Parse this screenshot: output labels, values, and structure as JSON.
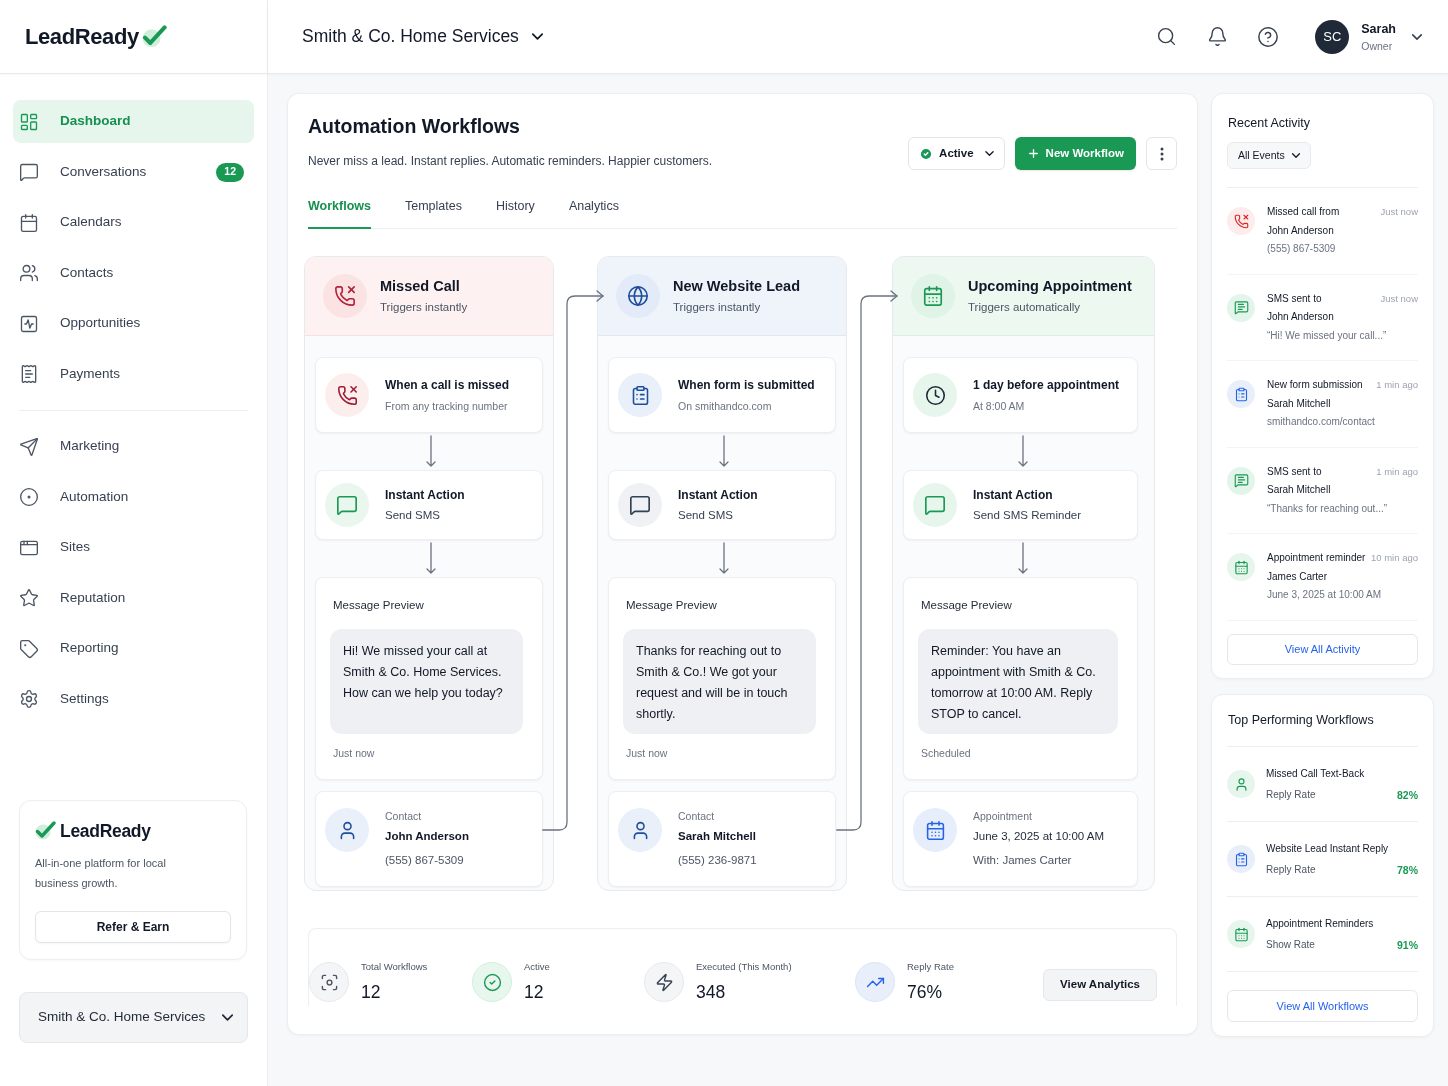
{
  "brand": {
    "name": "LeadReady"
  },
  "sidebar": {
    "sections": [
      {
        "items": [
          {
            "label": "Dashboard",
            "selected": true
          },
          {
            "label": "Conversations",
            "selected": false,
            "badge": "12"
          },
          {
            "label": "Calendars",
            "selected": false
          },
          {
            "label": "Contacts",
            "selected": false
          },
          {
            "label": "Opportunities",
            "selected": false
          },
          {
            "label": "Payments",
            "selected": false
          }
        ]
      },
      {
        "items": [
          {
            "label": "Marketing",
            "selected": false
          },
          {
            "label": "Automation",
            "selected": false
          },
          {
            "label": "Sites",
            "selected": false
          },
          {
            "label": "Reputation",
            "selected": false
          },
          {
            "label": "Reporting",
            "selected": false
          },
          {
            "label": "Settings",
            "selected": false
          }
        ]
      }
    ],
    "promo": {
      "brand": "LeadReady",
      "text": "All-in-one platform for local business growth.",
      "button": "Refer & Earn"
    },
    "account_select": {
      "value": "Smith & Co. Home Services"
    }
  },
  "top_bar": {
    "workspace": "Smith & Co. Home Services",
    "user": {
      "initials": "SC",
      "name": "Sarah",
      "role": "Owner"
    }
  },
  "page": {
    "title": "Automation Workflows",
    "subtitle": "Never miss a lead. Instant replies. Automatic reminders. Happier customers.",
    "status_filter": {
      "value": "Active"
    },
    "new_button": "New Workflow",
    "tabs": [
      {
        "label": "Workflows",
        "selected": true
      },
      {
        "label": "Templates",
        "selected": false
      },
      {
        "label": "History",
        "selected": false
      },
      {
        "label": "Analytics",
        "selected": false
      }
    ],
    "workflows": [
      {
        "kind": "call",
        "title": "Missed Call",
        "subtitle": "Triggers instantly",
        "trigger": {
          "title": "When a call is missed",
          "subtitle": "From any tracking number"
        },
        "action": {
          "label": "Instant Action",
          "value": "Send SMS"
        },
        "preview": {
          "label": "Message Preview",
          "message": "Hi! We missed your call at Smith & Co. Home Services. How can we help you today?",
          "footer": "Just now"
        },
        "info": {
          "kind": "contact",
          "label": "Contact",
          "lines": [
            "John Anderson",
            "(555) 867-5309"
          ]
        }
      },
      {
        "kind": "website_lead",
        "title": "New Website Lead",
        "subtitle": "Triggers instantly",
        "trigger": {
          "title": "When form is submitted",
          "subtitle": "On smithandco.com"
        },
        "action": {
          "label": "Instant Action",
          "value": "Send SMS"
        },
        "preview": {
          "label": "Message Preview",
          "message": "Thanks for reaching out to Smith & Co.! We got your request and will be in touch shortly.",
          "footer": "Just now"
        },
        "info": {
          "kind": "contact",
          "label": "Contact",
          "lines": [
            "Sarah Mitchell",
            "(555) 236-9871"
          ]
        }
      },
      {
        "kind": "appointment",
        "title": "Upcoming Appointment",
        "subtitle": "Triggers automatically",
        "trigger": {
          "title": "1 day before appointment",
          "subtitle": "At 8:00 AM"
        },
        "action": {
          "label": "Instant Action",
          "value": "Send SMS Reminder"
        },
        "preview": {
          "label": "Message Preview",
          "message": "Reminder: You have an appointment with Smith & Co. tomorrow at 10:00 AM. Reply STOP to cancel.",
          "footer": "Scheduled"
        },
        "info": {
          "kind": "appointment",
          "label": "Appointment",
          "lines": [
            "June 3, 2025 at 10:00 AM",
            "With: James Carter"
          ]
        }
      }
    ],
    "stats": [
      {
        "label": "Total Workflows",
        "value": "12"
      },
      {
        "label": "Active",
        "value": "12"
      },
      {
        "label": "Executed (This Month)",
        "value": "348"
      },
      {
        "label": "Reply Rate",
        "value": "76%"
      }
    ],
    "stats_button": "View Analytics"
  },
  "recent_activity": {
    "title": "Recent Activity",
    "filter": "All Events",
    "items": [
      {
        "kind": "call",
        "title": "Missed call from",
        "name": "John Anderson",
        "detail": "(555) 867-5309",
        "time": "Just now"
      },
      {
        "kind": "sms",
        "title": "SMS sent to",
        "name": "John Anderson",
        "detail": "“Hi! We missed your call...”",
        "time": "Just now"
      },
      {
        "kind": "form",
        "title": "New form submission",
        "name": "Sarah Mitchell",
        "detail": "smithandco.com/contact",
        "time": "1 min ago"
      },
      {
        "kind": "sms",
        "title": "SMS sent to",
        "name": "Sarah Mitchell",
        "detail": "“Thanks for reaching out...”",
        "time": "1 min ago"
      },
      {
        "kind": "appointment",
        "title": "Appointment reminder",
        "name": "James Carter",
        "detail": "June 3, 2025 at 10:00 AM",
        "time": "10 min ago"
      }
    ],
    "button": "View All Activity"
  },
  "top_workflows": {
    "title": "Top Performing Workflows",
    "items": [
      {
        "kind": "contact",
        "name": "Missed Call Text-Back",
        "metric": "Reply Rate",
        "value": "82%"
      },
      {
        "kind": "form",
        "name": "Website Lead Instant Reply",
        "metric": "Reply Rate",
        "value": "78%"
      },
      {
        "kind": "appointment",
        "name": "Appointment Reminders",
        "metric": "Show Rate",
        "value": "91%"
      }
    ],
    "button": "View All Workflows"
  }
}
